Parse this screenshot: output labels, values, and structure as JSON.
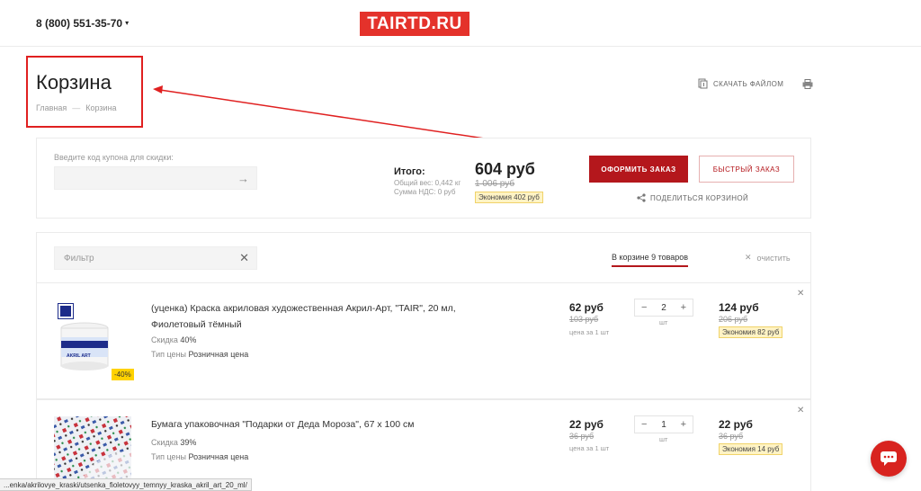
{
  "header": {
    "phone": "8 (800) 551-35-70",
    "logo": "TAIRTD.RU"
  },
  "page": {
    "title": "Корзина",
    "breadcrumb": [
      "Главная",
      "—",
      "Корзина"
    ],
    "download_label": "СКАЧАТЬ ФАЙЛОМ"
  },
  "summary": {
    "coupon_label": "Введите код купона для скидки:",
    "total_label": "Итого:",
    "weight": "Общий вес: 0,442 кг",
    "vat": "Сумма НДС: 0 руб",
    "total_price": "604 руб",
    "total_old": "1 006 руб",
    "economy": "Экономия 402 руб",
    "order_button": "ОФОРМИТЬ ЗАКАЗ",
    "quick_button": "БЫСТРЫЙ ЗАКАЗ",
    "share_label": "ПОДЕЛИТЬСЯ КОРЗИНОЙ"
  },
  "filter": {
    "placeholder": "Фильтр",
    "cart_count": "В корзине 9 товаров",
    "clear_label": "очистить"
  },
  "items": [
    {
      "name": "(уценка) Краска акриловая художественная Акрил-Арт, \"TAIR\", 20 мл, Фиолетовый тёмный",
      "discount_label": "Скидка",
      "discount_value": "40%",
      "price_type_label": "Тип цены",
      "price_type_value": "Розничная цена",
      "price": "62 руб",
      "price_old": "103 руб",
      "price_unit": "цена за 1 шт",
      "qty": "2",
      "qty_unit": "шт",
      "sum": "124 руб",
      "sum_old": "206 руб",
      "economy": "Экономия 82 руб",
      "badge": "-40%",
      "image_label": "AKRIL ART"
    },
    {
      "name": "Бумага упаковочная \"Подарки от Деда Мороза\", 67 х 100 см",
      "discount_label": "Скидка",
      "discount_value": "39%",
      "price_type_label": "Тип цены",
      "price_type_value": "Розничная цена",
      "price": "22 руб",
      "price_old": "36 руб",
      "price_unit": "цена за 1 шт",
      "qty": "1",
      "qty_unit": "шт",
      "sum": "22 руб",
      "sum_old": "36 руб",
      "economy": "Экономия 14 руб"
    }
  ],
  "status_url": "...enka/akrilovye_kraski/utsenka_fioletovyy_temnyy_kraska_akril_art_20_ml/",
  "colors": {
    "accent": "#b4171c",
    "logo": "#e4322b",
    "annotation": "#e02020",
    "badge": "#fff3c4"
  }
}
